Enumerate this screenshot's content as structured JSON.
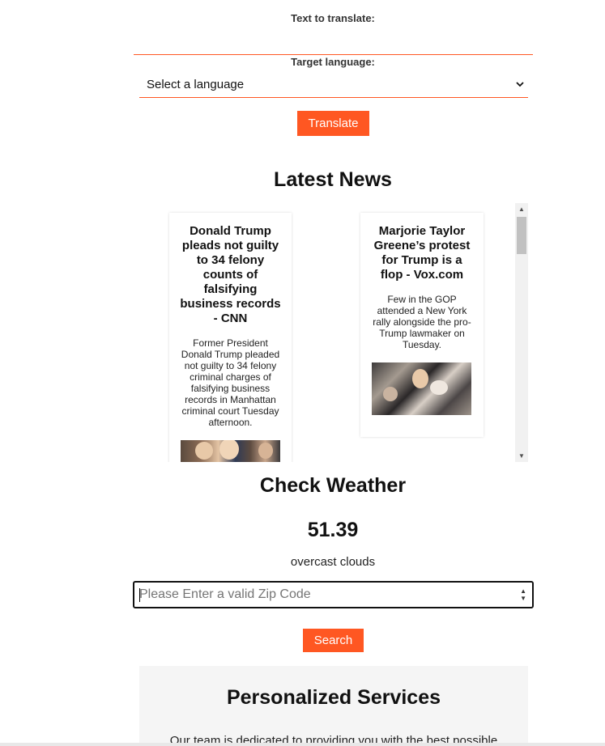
{
  "translate": {
    "text_label": "Text to translate:",
    "text_value": "",
    "target_label": "Target language:",
    "select_value": "Select a language",
    "button_label": "Translate"
  },
  "news": {
    "title": "Latest News",
    "articles": [
      {
        "headline": "Donald Trump pleads not guilty to 34 felony counts of falsifying business records - CNN",
        "description": "Former President Donald Trump pleaded not guilty to 34 felony criminal charges of falsifying business records in Manhattan criminal court Tuesday afternoon."
      },
      {
        "headline": "Marjorie Taylor Greene’s protest for Trump is a flop - Vox.com",
        "description": "Few in the GOP attended a New York rally alongside the pro-Trump lawmaker on Tuesday."
      }
    ]
  },
  "weather": {
    "title": "Check Weather",
    "temperature": "51.39",
    "description": "overcast clouds",
    "zip_placeholder": "Please Enter a valid Zip Code",
    "button_label": "Search"
  },
  "services": {
    "title": "Personalized Services",
    "text": "Our team is dedicated to providing you with the best possible"
  },
  "colors": {
    "accent": "#ff5722",
    "panel_bg": "#f5f5f5"
  }
}
